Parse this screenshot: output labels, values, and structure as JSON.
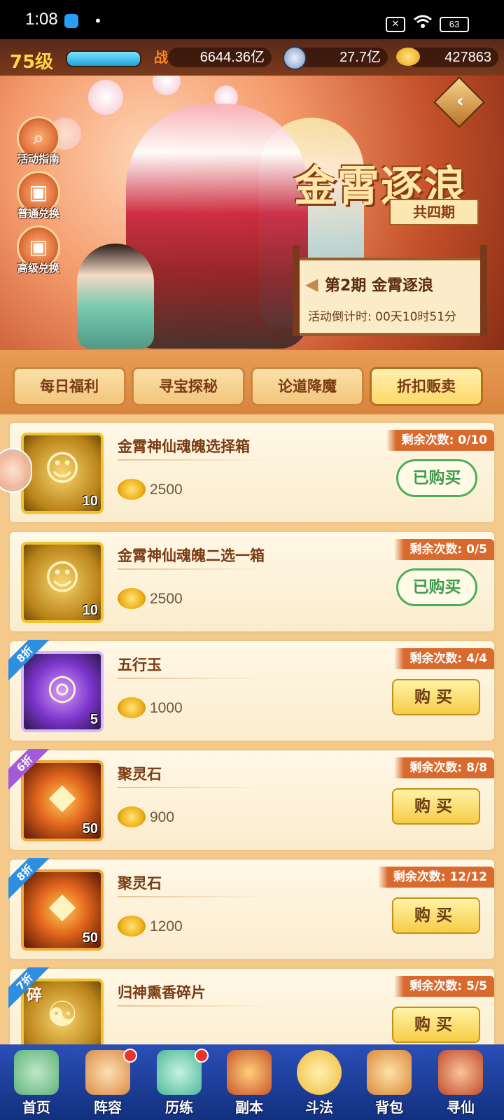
{
  "status_bar": {
    "time": "1:08",
    "dot": "•",
    "battery": "63",
    "x_label": "✕"
  },
  "resources": {
    "level": "75级",
    "combat_icon_label": "战",
    "combat_power": "6644.36亿",
    "copper": "27.7亿",
    "gold": "427863"
  },
  "banner": {
    "side_buttons": [
      {
        "label": "活动指南",
        "icon": "magnifier-icon"
      },
      {
        "label": "普通兑换",
        "icon": "gift-box-icon"
      },
      {
        "label": "高级兑换",
        "icon": "gift-box-icon"
      }
    ],
    "title": "金霄逐浪",
    "subtitle": "共四期",
    "period_title": "第2期  金霄逐浪",
    "countdown": "活动倒计时: 00天10时51分"
  },
  "tabs": [
    {
      "label": "每日福利",
      "active": false
    },
    {
      "label": "寻宝探秘",
      "active": false
    },
    {
      "label": "论道降魔",
      "active": false
    },
    {
      "label": "折扣贩卖",
      "active": true
    }
  ],
  "items": [
    {
      "name": "金霄神仙魂魄选择箱",
      "price": "2500",
      "qty": "10",
      "remain": "剩余次数: 0/10",
      "button": "已购买",
      "state": "bought",
      "discount": "",
      "icon_style": "gold",
      "glyph": "☺"
    },
    {
      "name": "金霄神仙魂魄二选一箱",
      "price": "2500",
      "qty": "10",
      "remain": "剩余次数: 0/5",
      "button": "已购买",
      "state": "bought",
      "discount": "",
      "icon_style": "gold",
      "glyph": "☺"
    },
    {
      "name": "五行玉",
      "price": "1000",
      "qty": "5",
      "remain": "剩余次数: 4/4",
      "button": "购买",
      "state": "buy",
      "discount": "8折",
      "discount_color": "blue",
      "icon_style": "purple",
      "glyph": "◎"
    },
    {
      "name": "聚灵石",
      "price": "900",
      "qty": "50",
      "remain": "剩余次数: 8/8",
      "button": "购买",
      "state": "buy",
      "discount": "6折",
      "discount_color": "purple",
      "icon_style": "red",
      "glyph": "◆"
    },
    {
      "name": "聚灵石",
      "price": "1200",
      "qty": "50",
      "remain": "剩余次数: 12/12",
      "button": "购买",
      "state": "buy",
      "discount": "8折",
      "discount_color": "blue",
      "icon_style": "red",
      "glyph": "◆"
    },
    {
      "name": "归神熏香碎片",
      "price": "",
      "qty": "",
      "remain": "剩余次数: 5/5",
      "button": "购买",
      "state": "buy",
      "discount": "7折",
      "discount_color": "blue",
      "icon_style": "gold",
      "glyph": "☯",
      "icon_badge": "碎"
    }
  ],
  "bottom_nav": [
    {
      "label": "首页",
      "icon": "home-icon",
      "dot": false,
      "color": "#5fb37a"
    },
    {
      "label": "阵容",
      "icon": "lineup-icon",
      "dot": true,
      "color": "#d98a4a"
    },
    {
      "label": "历练",
      "icon": "training-icon",
      "dot": true,
      "color": "#4cb89a"
    },
    {
      "label": "副本",
      "icon": "dungeon-icon",
      "dot": false,
      "color": "#c8552a"
    },
    {
      "label": "斗法",
      "icon": "battle-icon",
      "dot": false,
      "color": "#f0b83a"
    },
    {
      "label": "背包",
      "icon": "bag-icon",
      "dot": false,
      "color": "#d9883a"
    },
    {
      "label": "寻仙",
      "icon": "seek-icon",
      "dot": false,
      "color": "#c24a2a"
    }
  ],
  "colors": {
    "accent": "#d96a2e",
    "bought_green": "#3f9a4e",
    "buy_yellow": "#f7cc46"
  }
}
